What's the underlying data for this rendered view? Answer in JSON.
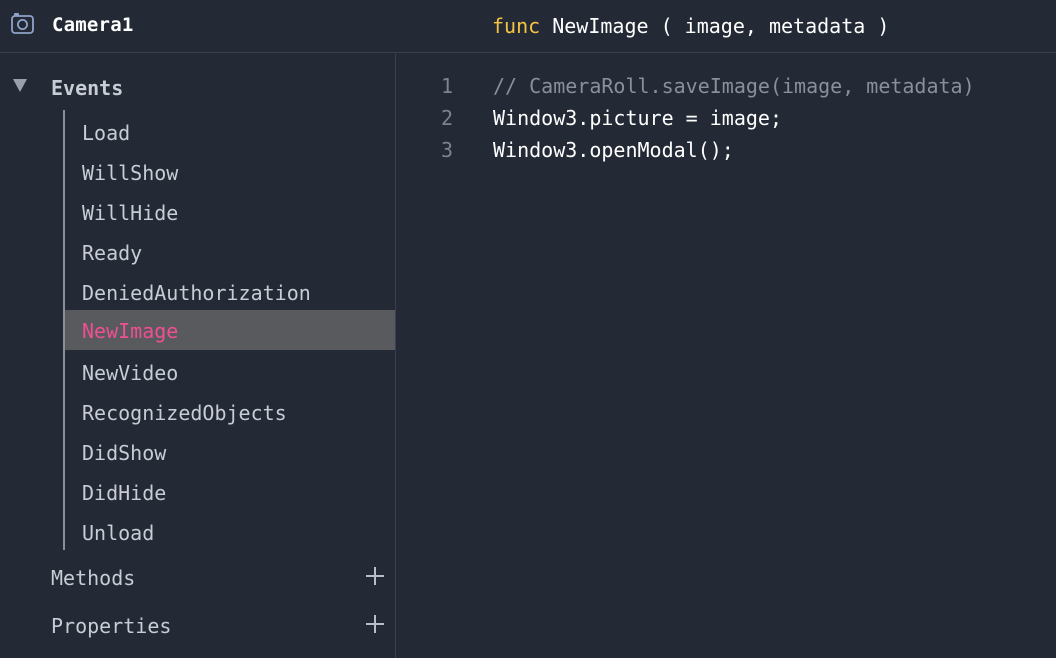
{
  "header": {
    "component_icon": "camera-icon",
    "component_name": "Camera1",
    "func_keyword": "func",
    "func_name": "NewImage",
    "func_params": " ( image, metadata )"
  },
  "sidebar": {
    "events_label": "Events",
    "events": [
      {
        "label": "Load",
        "selected": false
      },
      {
        "label": "WillShow",
        "selected": false
      },
      {
        "label": "WillHide",
        "selected": false
      },
      {
        "label": "Ready",
        "selected": false
      },
      {
        "label": "DeniedAuthorization",
        "selected": false
      },
      {
        "label": "NewImage",
        "selected": true
      },
      {
        "label": "NewVideo",
        "selected": false
      },
      {
        "label": "RecognizedObjects",
        "selected": false
      },
      {
        "label": "DidShow",
        "selected": false
      },
      {
        "label": "DidHide",
        "selected": false
      },
      {
        "label": "Unload",
        "selected": false
      }
    ],
    "methods_label": "Methods",
    "properties_label": "Properties",
    "add_icon": "plus-icon"
  },
  "editor": {
    "lines": [
      {
        "number": "1",
        "text": "// CameraRoll.saveImage(image, metadata)"
      },
      {
        "number": "2",
        "text": "Window3.picture = image;"
      },
      {
        "number": "3",
        "text": "Window3.openModal();"
      }
    ]
  },
  "colors": {
    "background": "#232935",
    "keyword": "#f6c343",
    "selected_text": "#ef4f93",
    "selected_bg": "#585a5e",
    "comment": "#8a8f99"
  }
}
